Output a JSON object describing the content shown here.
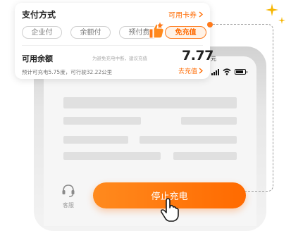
{
  "payment_card": {
    "title": "支付方式",
    "coupon_link": "可用卡券",
    "methods": [
      {
        "label": "企业付",
        "active": false
      },
      {
        "label": "余额付",
        "active": false
      },
      {
        "label": "预付费",
        "active": false
      },
      {
        "label": "免充值",
        "active": true
      }
    ],
    "balance_label": "可用余额",
    "balance_hint": "为避免充电中断，建议充值",
    "balance_amount": "7.77",
    "balance_unit": "元",
    "balance_detail": "预计可充电5.75度，可行驶32.22公里",
    "recharge_link": "去充值"
  },
  "bottom_bar": {
    "service_label": "客服",
    "stop_button": "停止充电"
  },
  "colors": {
    "accent": "#ff6a00",
    "accent_light": "#fff2e6",
    "sparkle": "#f6b500"
  },
  "icons": [
    "chevron-right-icon",
    "thumbs-up-icon",
    "sparkle-icon",
    "headset-icon",
    "pointer-hand-icon",
    "signal-icon",
    "wifi-icon",
    "battery-icon"
  ]
}
